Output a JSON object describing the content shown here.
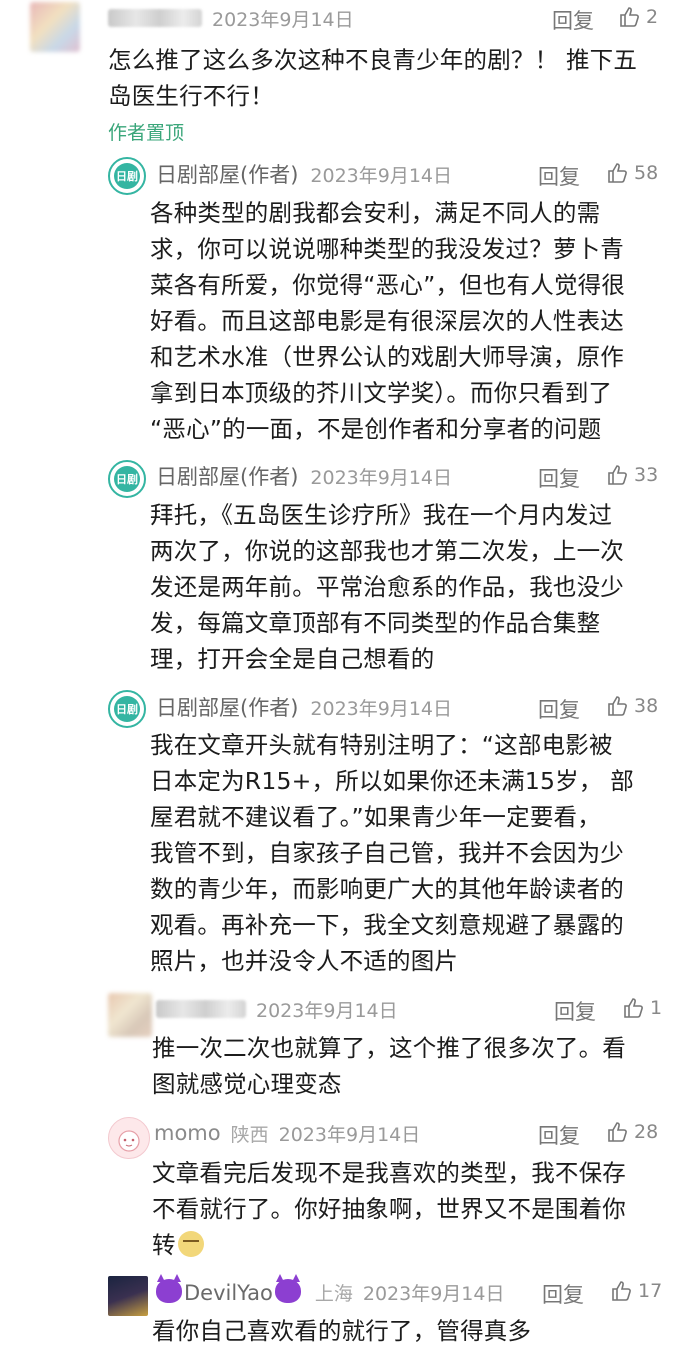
{
  "comments": [
    {
      "name": "",
      "time": "2023年9月14日",
      "reply": "回复",
      "likes": "2",
      "pinned_label": "作者置顶",
      "lines": [
        "怎么推了这么多次这种不良青少年的剧？！ 推下五",
        "岛医生行不行！"
      ]
    },
    {
      "name": "日剧部屋(作者)",
      "avatar_text": "日剧",
      "time": "2023年9月14日",
      "reply": "回复",
      "likes": "58",
      "lines": [
        "各种类型的剧我都会安利，满足不同人的需",
        "求，你可以说说哪种类型的我没发过？萝卜青",
        "菜各有所爱，你觉得“恶心”，但也有人觉得很",
        "好看。而且这部电影是有很深层次的人性表达",
        "和艺术水准（世界公认的戏剧大师导演，原作",
        "拿到日本顶级的芥川文学奖）。而你只看到了",
        "“恶心”的一面，不是创作者和分享者的问题"
      ]
    },
    {
      "name": "日剧部屋(作者)",
      "avatar_text": "日剧",
      "time": "2023年9月14日",
      "reply": "回复",
      "likes": "33",
      "lines": [
        "拜托，《五岛医生诊疗所》我在一个月内发过",
        "两次了，你说的这部我也才第二次发，上一次",
        "发还是两年前。平常治愈系的作品，我也没少",
        "发，每篇文章顶部有不同类型的作品合集整",
        "理，打开会全是自己想看的"
      ]
    },
    {
      "name": "日剧部屋(作者)",
      "avatar_text": "日剧",
      "time": "2023年9月14日",
      "reply": "回复",
      "likes": "38",
      "lines": [
        "我在文章开头就有特别注明了：“这部电影被",
        "日本定为R15+，所以如果你还未满15岁， 部",
        "屋君就不建议看了。”如果青少年一定要看，",
        "我管不到，自家孩子自己管，我并不会因为少",
        "数的青少年，而影响更广大的其他年龄读者的",
        "观看。再补充一下，我全文刻意规避了暴露的",
        "照片，也并没令人不适的图片"
      ]
    },
    {
      "name": "",
      "time": "2023年9月14日",
      "reply": "回复",
      "likes": "1",
      "lines": [
        "推一次二次也就算了，这个推了很多次了。看",
        "图就感觉心理变态"
      ]
    },
    {
      "name": "momo",
      "location": "陕西",
      "time": "2023年9月14日",
      "reply": "回复",
      "likes": "28",
      "lines": [
        "文章看完后发现不是我喜欢的类型，我不保存",
        "不看就行了。你好抽象啊，世界又不是围着你",
        "转"
      ]
    },
    {
      "name": "DevilYao",
      "location": "上海",
      "time": "2023年9月14日",
      "reply": "回复",
      "likes": "17",
      "lines": [
        "看你自己喜欢看的就行了，管得真多"
      ]
    }
  ],
  "colors": {
    "author_teal": "#34b5a2",
    "pinned_green": "#3aa67a"
  }
}
